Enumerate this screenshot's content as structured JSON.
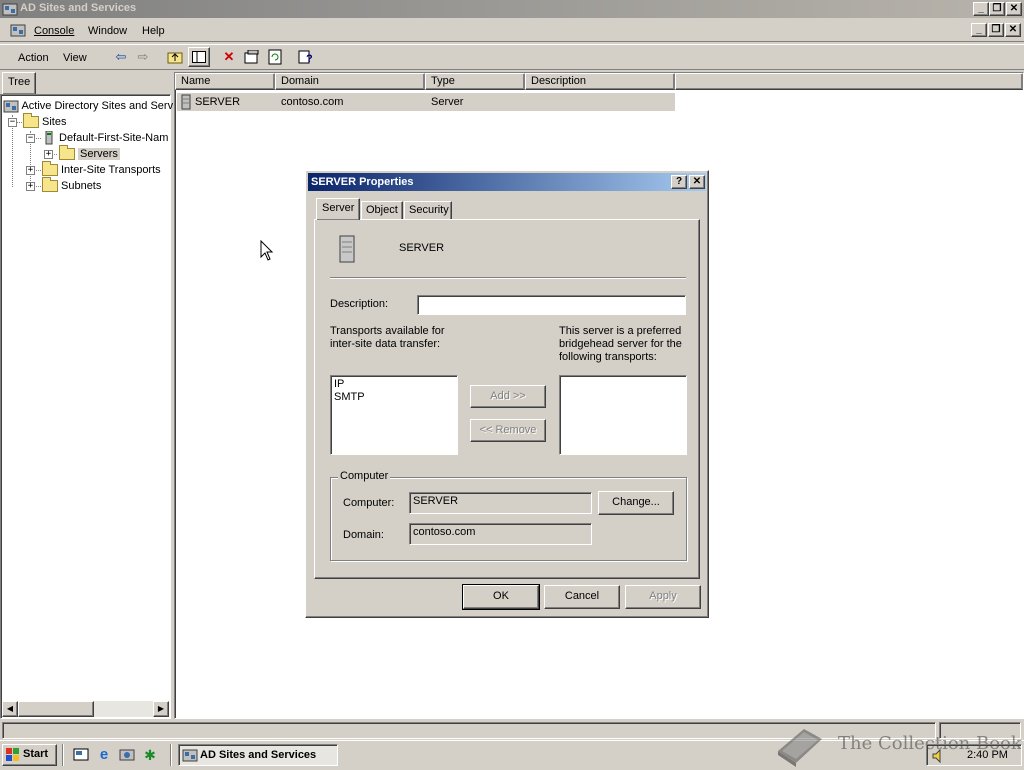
{
  "window": {
    "title": "AD Sites and Services"
  },
  "menu": {
    "console": "Console",
    "window": "Window",
    "help": "Help"
  },
  "toolbar": {
    "action": "Action",
    "view": "View"
  },
  "tree": {
    "tab": "Tree",
    "root": "Active Directory Sites and Serv",
    "sites": "Sites",
    "site_name": "Default-First-Site-Nam",
    "servers": "Servers",
    "inter_site": "Inter-Site Transports",
    "subnets": "Subnets"
  },
  "list": {
    "columns": [
      "Name",
      "Domain",
      "Type",
      "Description"
    ],
    "rows": [
      {
        "name": "SERVER",
        "domain": "contoso.com",
        "type": "Server",
        "description": ""
      }
    ]
  },
  "dialog": {
    "title": "SERVER Properties",
    "tabs": [
      "Server",
      "Object",
      "Security"
    ],
    "server_name": "SERVER",
    "description_label": "Description:",
    "description_value": "",
    "transports_label": "Transports available for inter-site data transfer:",
    "transports": [
      "IP",
      "SMTP"
    ],
    "bridgehead_label": "This server is a preferred bridgehead server for the following transports:",
    "add_label": "Add >>",
    "remove_label": "<< Remove",
    "computer_group": "Computer",
    "computer_label": "Computer:",
    "computer_value": "SERVER",
    "change_label": "Change...",
    "domain_label": "Domain:",
    "domain_value": "contoso.com",
    "ok": "OK",
    "cancel": "Cancel",
    "apply": "Apply"
  },
  "taskbar": {
    "start": "Start",
    "task": "AD Sites and Services",
    "clock": "2:40 PM"
  },
  "watermark": "The Collection Book",
  "colors": {
    "active_title": "#0a246a",
    "inactive_title": "#808080",
    "face": "#d4d0c8"
  }
}
